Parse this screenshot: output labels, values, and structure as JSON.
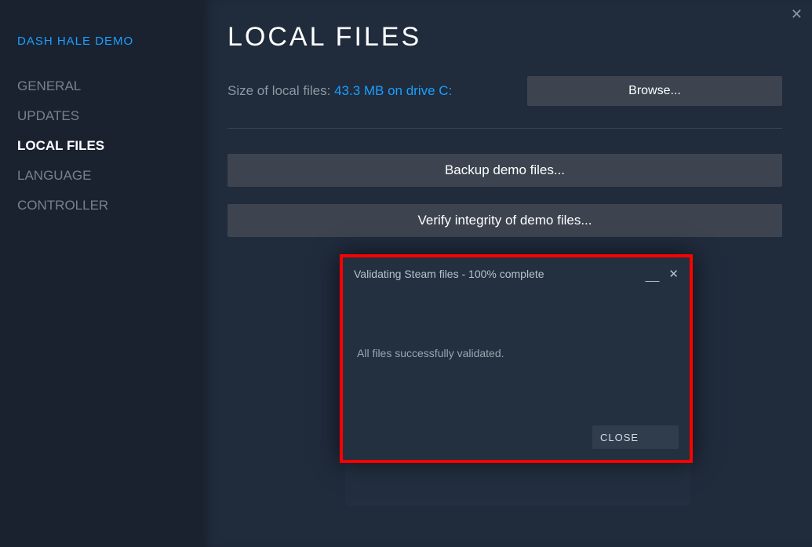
{
  "sidebar": {
    "game_title": "DASH HALE DEMO",
    "items": [
      {
        "label": "GENERAL",
        "active": false
      },
      {
        "label": "UPDATES",
        "active": false
      },
      {
        "label": "LOCAL FILES",
        "active": true
      },
      {
        "label": "LANGUAGE",
        "active": false
      },
      {
        "label": "CONTROLLER",
        "active": false
      }
    ]
  },
  "main": {
    "title": "LOCAL FILES",
    "size_label": "Size of local files: ",
    "size_value": "43.3 MB on drive C:",
    "browse_label": "Browse...",
    "backup_label": "Backup demo files...",
    "verify_label": "Verify integrity of demo files..."
  },
  "dialog": {
    "title": "Validating Steam files - 100% complete",
    "message": "All files successfully validated.",
    "close_label": "CLOSE"
  }
}
